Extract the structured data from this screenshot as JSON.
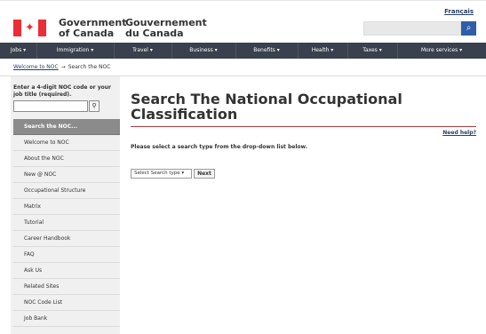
{
  "header": {
    "lang_link": "Français",
    "signature_en": [
      "Government",
      "of Canada"
    ],
    "signature_fr": [
      "Gouvernement",
      "du Canada"
    ],
    "search_icon": "search-icon"
  },
  "menu": [
    "Jobs ▾",
    "Immigration ▾",
    "Travel ▾",
    "Business ▾",
    "Benefits ▾",
    "Health ▾",
    "Taxes ▾",
    "More services ▾"
  ],
  "breadcrumb": {
    "home": "Welcome to NOC",
    "arrow": "→",
    "current": "Search the NOC"
  },
  "sidebar": {
    "prompt": "Enter a 4-digit NOC code or your job title (required).",
    "search_value": "",
    "items": [
      "Search the NOC...",
      "Welcome to NOC",
      "About the NOC",
      "New @ NOC",
      "Occupational Structure",
      "Matrix",
      "Tutorial",
      "Career Handbook",
      "FAQ",
      "Ask Us",
      "Related Sites",
      "NOC Code List",
      "Job Bank"
    ]
  },
  "main": {
    "title": "Search The National Occupational Classification",
    "help": "Need help?",
    "instruction": "Please select a search type from the drop-down list below.",
    "select_value": "Select Search type ▾",
    "next_button": "Next"
  },
  "colors": {
    "menu_bg": "#38414d",
    "accent_red": "#eb2d37",
    "active_nav": "#8b8b8b",
    "title_rule": "#af3c43"
  }
}
